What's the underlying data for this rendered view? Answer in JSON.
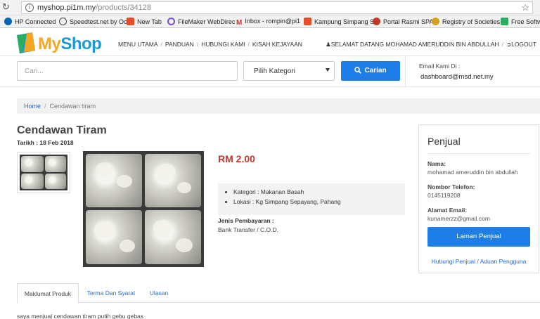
{
  "browser": {
    "url_host": "myshop.pi1m.my",
    "url_path": "/products/34128",
    "bookmarks": [
      {
        "label": "HP Connected",
        "icon": "hp-icon",
        "color": "#0067b4"
      },
      {
        "label": "Speedtest.net by Ooi",
        "icon": "speedtest-icon",
        "color": "#444444"
      },
      {
        "label": "New Tab",
        "icon": "joomla-icon",
        "color": "#e44d26"
      },
      {
        "label": "FileMaker WebDirec",
        "icon": "filemaker-icon",
        "color": "#7b4fcf"
      },
      {
        "label": "Inbox - rompin@pi1",
        "icon": "gmail-icon",
        "color": "#d93025"
      },
      {
        "label": "Kampung Simpang S",
        "icon": "joomla-icon",
        "color": "#e44d26"
      },
      {
        "label": "Portal Rasmi SPA",
        "icon": "spa-icon",
        "color": "#c0392b"
      },
      {
        "label": "Registry of Societies",
        "icon": "ros-icon",
        "color": "#d4a017"
      },
      {
        "label": "Free Softwa",
        "icon": "software-icon",
        "color": "#27ae60"
      }
    ]
  },
  "header": {
    "logo_my": "My",
    "logo_shop": "Shop",
    "nav": [
      "MENU UTAMA",
      "PANDUAN",
      "HUBUNGI KAMI",
      "KISAH KEJAYAAN"
    ],
    "welcome": "SELAMAT DATANG MOHAMAD AMERUDDIN BIN ABDULLAH",
    "logout": "LOGOUT"
  },
  "search": {
    "placeholder": "Cari...",
    "category": "Pilih Kategori",
    "button": "Carian",
    "email_label": "Email Kami Di :",
    "email": "dashboard@msd.net.my"
  },
  "breadcrumb": {
    "home": "Home",
    "current": "Cendawan tiram"
  },
  "product": {
    "title": "Cendawan Tiram",
    "date": "Tarikh : 18 Feb 2018",
    "price": "RM 2.00",
    "category": "Kategori : Makanan Basah",
    "location": "Lokasi : Kg Simpang Sepayang, Pahang",
    "payment_label": "Jenis Pembayaran :",
    "payment": "Bank Transfer / C.O.D."
  },
  "seller": {
    "heading": "Penjual",
    "name_label": "Nama:",
    "name": "mohamad ameruddin bin abdullah",
    "phone_label": "Nombor Telefon:",
    "phone": "0145119208",
    "email_label": "Alamat Email:",
    "email": "kunamerzz@gmail.com",
    "button": "Laman Penjual",
    "contact_link": "Hubungi Penjual",
    "report_link": "Aduan Pengguna"
  },
  "tabs": [
    "Maklumat Produk",
    "Terma Dan Syarat",
    "Ulasan"
  ],
  "description": "saya menjual cendawan tiram putih gebu gebas",
  "colors": {
    "accent": "#1e7ee8",
    "price": "#c0392b",
    "logo_orange": "#f5a623",
    "logo_blue": "#1b9ad6"
  }
}
